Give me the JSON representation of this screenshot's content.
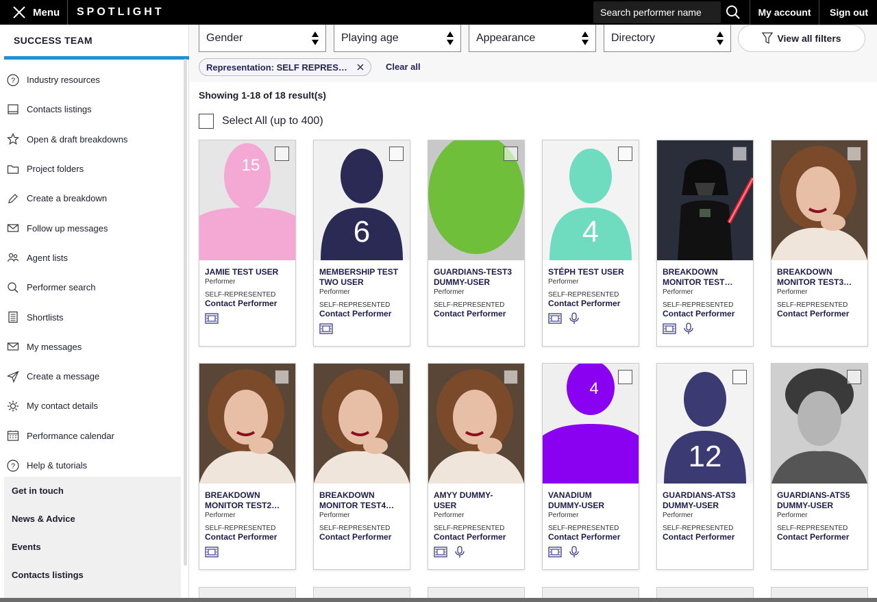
{
  "topbar": {
    "menu_label": "Menu",
    "logo": "SPOTLIGHT",
    "search_placeholder": "Search performer name",
    "my_account": "My account",
    "sign_out": "Sign out"
  },
  "sidebar": {
    "title": "SUCCESS TEAM",
    "items": [
      {
        "label": "Industry resources",
        "icon": "question-icon"
      },
      {
        "label": "Contacts listings",
        "icon": "book-icon"
      },
      {
        "label": "Open & draft breakdowns",
        "icon": "star-icon"
      },
      {
        "label": "Project folders",
        "icon": "folder-icon"
      },
      {
        "label": "Create a breakdown",
        "icon": "pencil-icon"
      },
      {
        "label": "Follow up messages",
        "icon": "envelope-icon"
      },
      {
        "label": "Agent lists",
        "icon": "people-icon"
      },
      {
        "label": "Performer search",
        "icon": "search-icon"
      },
      {
        "label": "Shortlists",
        "icon": "list-icon"
      },
      {
        "label": "My messages",
        "icon": "envelope-icon"
      },
      {
        "label": "Create a message",
        "icon": "send-icon"
      },
      {
        "label": "My contact details",
        "icon": "gear-icon"
      },
      {
        "label": "Performance calendar",
        "icon": "calendar-icon"
      },
      {
        "label": "Help & tutorials",
        "icon": "question-icon"
      }
    ],
    "footer": [
      "Get in touch",
      "News & Advice",
      "Events",
      "Contacts listings"
    ]
  },
  "filters": {
    "gender": "Gender",
    "playing_age": "Playing age",
    "appearance": "Appearance",
    "directory": "Directory",
    "view_all": "View all filters",
    "chip": "Representation: SELF REPRES…",
    "clear_all": "Clear all"
  },
  "results": {
    "showing": "Showing 1-18 of 18 result(s)",
    "select_all": "Select All (up to 400)"
  },
  "common": {
    "role": "Performer",
    "rep": "SELF-REPRESENTED",
    "contact": "Contact Performer"
  },
  "cards": [
    {
      "name": "JAMIE TEST USER",
      "photo": "silhouette-pink-15",
      "showreel": true,
      "audio": false
    },
    {
      "name": "MEMBERSHIP TEST\nTWO USER",
      "photo": "silhouette-navy-6",
      "showreel": true,
      "audio": false
    },
    {
      "name": "GUARDIANS-TEST3\nDUMMY-USER",
      "photo": "silhouette-green",
      "showreel": false,
      "audio": false
    },
    {
      "name": "STÉPH TEST USER",
      "photo": "silhouette-mint-4",
      "showreel": true,
      "audio": true
    },
    {
      "name": "BREAKDOWN\nMONITOR TEST…",
      "photo": "photo-darth-vader",
      "showreel": true,
      "audio": true
    },
    {
      "name": "BREAKDOWN\nMONITOR TEST3…",
      "photo": "photo-woman-curly-hair",
      "showreel": false,
      "audio": false
    },
    {
      "name": "BREAKDOWN\nMONITOR TEST2…",
      "photo": "photo-woman-curly-hair",
      "showreel": true,
      "audio": false
    },
    {
      "name": "BREAKDOWN\nMONITOR TEST4…",
      "photo": "photo-woman-curly-hair",
      "showreel": false,
      "audio": false
    },
    {
      "name": "AMYY DUMMY-\nUSER",
      "photo": "photo-woman-curly-hair",
      "showreel": true,
      "audio": true
    },
    {
      "name": "VANADIUM\nDUMMY-USER",
      "photo": "silhouette-purple-4",
      "showreel": true,
      "audio": true
    },
    {
      "name": "GUARDIANS-ATS3\nDUMMY-USER",
      "photo": "silhouette-navy-12",
      "showreel": false,
      "audio": false
    },
    {
      "name": "GUARDIANS-ATS5\nDUMMY-USER",
      "photo": "photo-man-bw",
      "showreel": false,
      "audio": false
    }
  ],
  "colors": {
    "accent_blue": "#1f8fd6",
    "navy": "#24245a",
    "pink": "#f4a8d4",
    "green": "#6fbf3a",
    "mint": "#6fdcc0",
    "purple": "#8a00f0",
    "slate": "#3b3a72"
  }
}
